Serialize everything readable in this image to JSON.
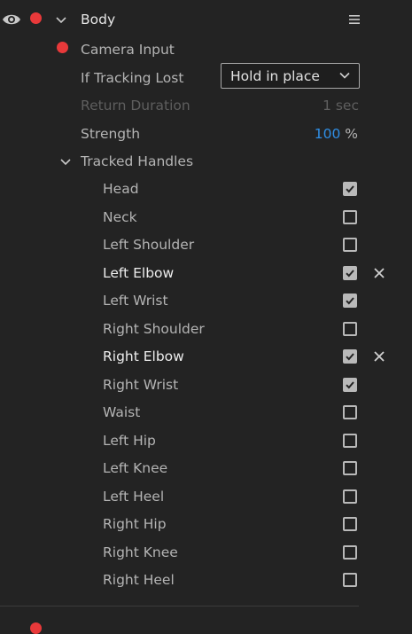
{
  "header": {
    "title": "Body",
    "menu_icon": "hamburger-icon",
    "visibility_icon": "eye-icon",
    "expand_icon": "chevron-down-icon"
  },
  "camera_input": {
    "label": "Camera Input"
  },
  "tracking_lost": {
    "label": "If Tracking Lost",
    "selected": "Hold in place"
  },
  "return_duration": {
    "label": "Return Duration",
    "value": "1 sec"
  },
  "strength": {
    "label": "Strength",
    "value": "100",
    "unit": "%"
  },
  "tracked_handles": {
    "label": "Tracked Handles",
    "items": [
      {
        "label": "Head",
        "checked": true,
        "bold": false,
        "removable": false
      },
      {
        "label": "Neck",
        "checked": false,
        "bold": false,
        "removable": false
      },
      {
        "label": "Left Shoulder",
        "checked": false,
        "bold": false,
        "removable": false
      },
      {
        "label": "Left Elbow",
        "checked": true,
        "bold": true,
        "removable": true
      },
      {
        "label": "Left Wrist",
        "checked": true,
        "bold": false,
        "removable": false
      },
      {
        "label": "Right Shoulder",
        "checked": false,
        "bold": false,
        "removable": false
      },
      {
        "label": "Right Elbow",
        "checked": true,
        "bold": true,
        "removable": true
      },
      {
        "label": "Right Wrist",
        "checked": true,
        "bold": false,
        "removable": false
      },
      {
        "label": "Waist",
        "checked": false,
        "bold": false,
        "removable": false
      },
      {
        "label": "Left Hip",
        "checked": false,
        "bold": false,
        "removable": false
      },
      {
        "label": "Left Knee",
        "checked": false,
        "bold": false,
        "removable": false
      },
      {
        "label": "Left Heel",
        "checked": false,
        "bold": false,
        "removable": false
      },
      {
        "label": "Right Hip",
        "checked": false,
        "bold": false,
        "removable": false
      },
      {
        "label": "Right Knee",
        "checked": false,
        "bold": false,
        "removable": false
      },
      {
        "label": "Right Heel",
        "checked": false,
        "bold": false,
        "removable": false
      }
    ]
  },
  "colors": {
    "background": "#232323",
    "record_dot": "#e8393a",
    "accent_blue": "#2f8fe6",
    "checkbox": "#b9b9b9"
  }
}
